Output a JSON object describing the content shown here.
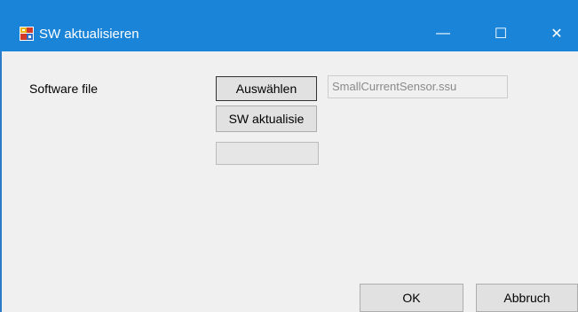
{
  "window": {
    "title": "SW aktualisieren",
    "icons": {
      "app": "app-icon",
      "minimize": "minimize-icon",
      "maximize": "maximize-icon",
      "close": "close-icon"
    },
    "glyphs": {
      "minimize": "—",
      "maximize": "☐",
      "close": "✕"
    },
    "colors": {
      "titlebar": "#1a84d8",
      "background": "#f0f0f0"
    }
  },
  "form": {
    "software_label": "Software file",
    "select_button": "Auswählen",
    "file_value": "SmallCurrentSensor.ssu",
    "update_button": "SW aktualisie",
    "progress_percent": 0
  },
  "footer": {
    "ok_button": "OK",
    "cancel_button": "Abbruch"
  }
}
